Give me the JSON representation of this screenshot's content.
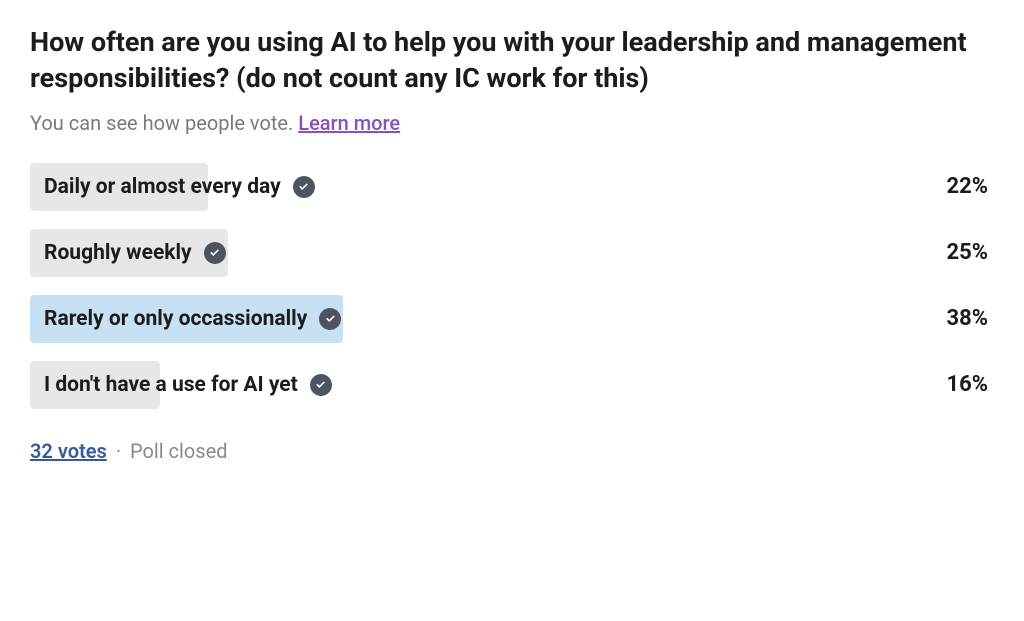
{
  "poll": {
    "question": "How often are you using AI to help you with your leadership and management responsibilities? (do not count any IC work for this)",
    "subtext": "You can see how people vote. ",
    "learn_more_label": "Learn more",
    "options": [
      {
        "label": "Daily or almost every day",
        "percent": 22,
        "percent_label": "22%",
        "bar_width": 18.5,
        "selected": false
      },
      {
        "label": "Roughly weekly",
        "percent": 25,
        "percent_label": "25%",
        "bar_width": 20.5,
        "selected": false
      },
      {
        "label": "Rarely or only occassionally",
        "percent": 38,
        "percent_label": "38%",
        "bar_width": 32.5,
        "selected": true
      },
      {
        "label": "I don't have a use for AI yet",
        "percent": 16,
        "percent_label": "16%",
        "bar_width": 13.5,
        "selected": false
      }
    ],
    "vote_count_label": "32 votes",
    "status_label": "Poll closed"
  },
  "chart_data": {
    "type": "bar",
    "title": "How often are you using AI to help you with your leadership and management responsibilities? (do not count any IC work for this)",
    "categories": [
      "Daily or almost every day",
      "Roughly weekly",
      "Rarely or only occassionally",
      "I don't have a use for AI yet"
    ],
    "values": [
      22,
      25,
      38,
      16
    ],
    "unit": "percent",
    "total_votes": 32,
    "xlabel": "",
    "ylabel": "",
    "ylim": [
      0,
      100
    ]
  }
}
